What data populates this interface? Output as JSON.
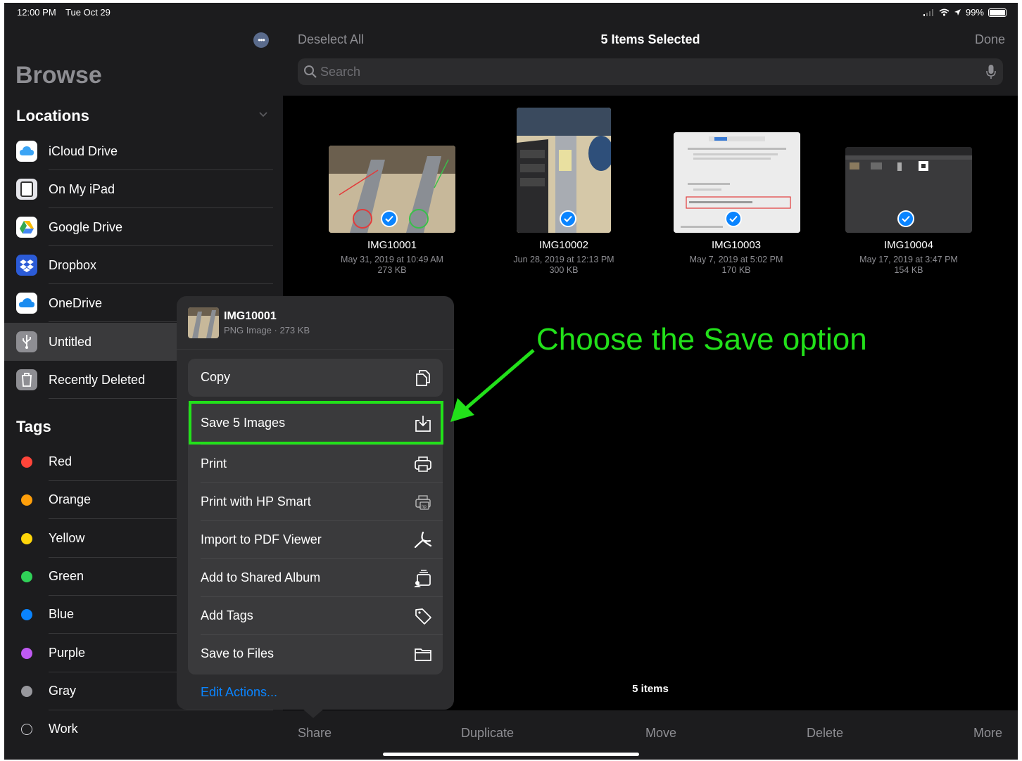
{
  "status": {
    "time": "12:00 PM",
    "date": "Tue Oct 29",
    "battery": "99%"
  },
  "sidebar": {
    "more_label": "•••",
    "title": "Browse",
    "locations_header": "Locations",
    "locations": [
      {
        "label": "iCloud Drive",
        "icon": "icloud-icon"
      },
      {
        "label": "On My iPad",
        "icon": "ipad-icon"
      },
      {
        "label": "Google Drive",
        "icon": "google-drive-icon"
      },
      {
        "label": "Dropbox",
        "icon": "dropbox-icon"
      },
      {
        "label": "OneDrive",
        "icon": "onedrive-icon"
      },
      {
        "label": "Untitled",
        "icon": "usb-icon",
        "selected": true
      },
      {
        "label": "Recently Deleted",
        "icon": "trash-icon"
      }
    ],
    "tags_header": "Tags",
    "tags": [
      {
        "label": "Red",
        "color": "#ff453a"
      },
      {
        "label": "Orange",
        "color": "#ff9f0a"
      },
      {
        "label": "Yellow",
        "color": "#ffd60a"
      },
      {
        "label": "Green",
        "color": "#30d158"
      },
      {
        "label": "Blue",
        "color": "#0a84ff"
      },
      {
        "label": "Purple",
        "color": "#bf5af2"
      },
      {
        "label": "Gray",
        "color": "#98989d"
      },
      {
        "label": "Work",
        "color": "outline"
      }
    ]
  },
  "main": {
    "deselect_label": "Deselect All",
    "title": "5 Items Selected",
    "done_label": "Done",
    "search_placeholder": "Search",
    "files": [
      {
        "name": "IMG10001",
        "date": "May 31, 2019 at 10:49 AM",
        "size": "273 KB"
      },
      {
        "name": "IMG10002",
        "date": "Jun 28, 2019 at 12:13 PM",
        "size": "300 KB"
      },
      {
        "name": "IMG10003",
        "date": "May 7, 2019 at 5:02 PM",
        "size": "170 KB"
      },
      {
        "name": "IMG10004",
        "date": "May 17, 2019 at 3:47 PM",
        "size": "154 KB"
      }
    ],
    "items_count": "5 items",
    "toolbar": {
      "share": "Share",
      "duplicate": "Duplicate",
      "move": "Move",
      "delete": "Delete",
      "more": "More"
    }
  },
  "share_sheet": {
    "file_name": "IMG10001",
    "file_info": "PNG Image · 273 KB",
    "actions": [
      {
        "label": "Copy",
        "icon": "copy-icon"
      },
      {
        "label": "Save 5 Images",
        "icon": "save-image-icon"
      },
      {
        "label": "Print",
        "icon": "printer-icon"
      },
      {
        "label": "Print with HP Smart",
        "icon": "hp-smart-icon"
      },
      {
        "label": "Import to PDF Viewer",
        "icon": "pdf-viewer-icon"
      },
      {
        "label": "Add to Shared Album",
        "icon": "shared-album-icon"
      },
      {
        "label": "Add Tags",
        "icon": "tag-icon"
      },
      {
        "label": "Save to Files",
        "icon": "folder-icon"
      }
    ],
    "edit_actions": "Edit Actions..."
  },
  "annotation": {
    "text": "Choose the Save option",
    "color": "#22e11a"
  }
}
